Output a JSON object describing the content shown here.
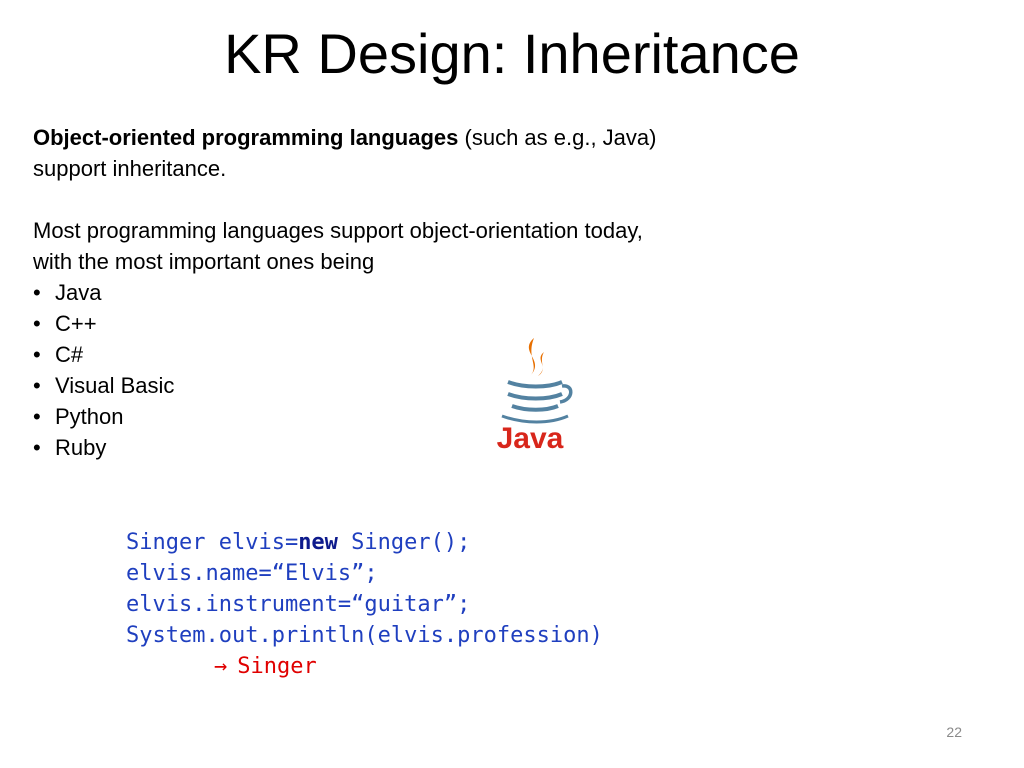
{
  "slide": {
    "title": "KR Design: Inheritance",
    "intro_bold": "Object-oriented programming languages",
    "intro_rest": " (such as e.g., Java)",
    "intro_line2": "support inheritance.",
    "para2_line1": "Most programming languages support object-orientation today,",
    "para2_line2": "with the most important ones being",
    "bullet_char": "•",
    "languages": [
      "Java",
      "C++",
      "C#",
      "Visual Basic",
      "Python",
      "Ruby"
    ],
    "logo": {
      "icon": "java-coffee-cup-logo",
      "text": "Java",
      "color_cup": "#e76f00",
      "color_text": "#d8261b",
      "color_lines": "#5382a1"
    },
    "code": {
      "line1_pre": "Singer elvis=",
      "line1_kw": "new",
      "line1_post": " Singer();",
      "line2": "elvis.name=“Elvis”;",
      "line3": "elvis.instrument=“guitar”;",
      "line4": "System.out.println(elvis.profession)",
      "arrow": "→",
      "output": "Singer"
    },
    "page_number": "22"
  }
}
